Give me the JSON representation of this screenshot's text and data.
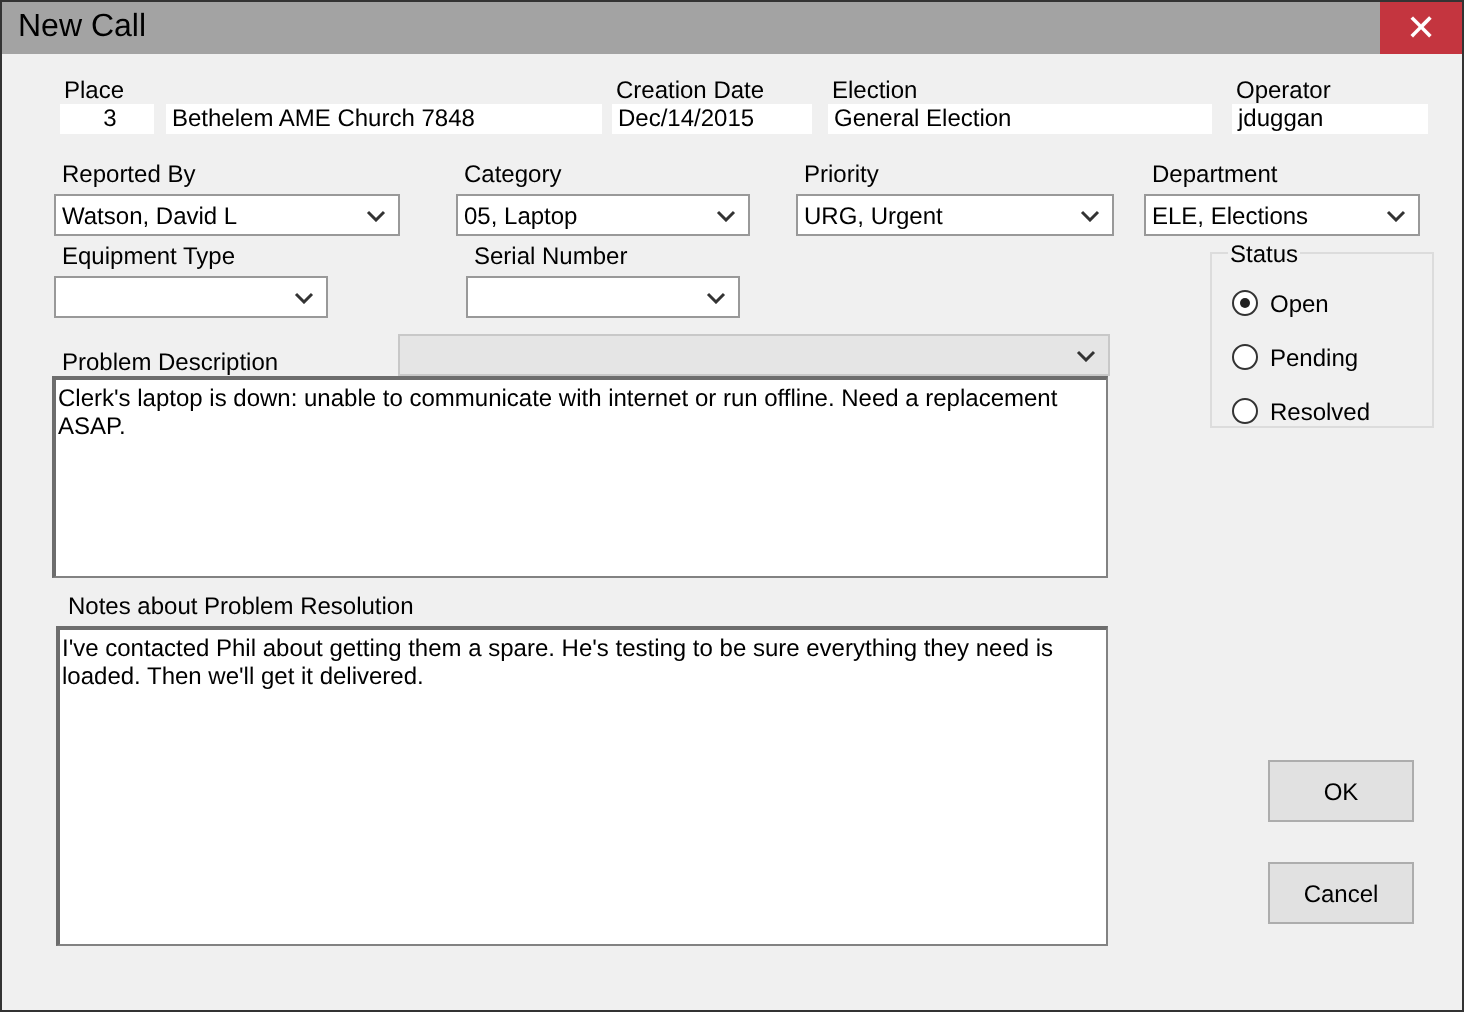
{
  "window": {
    "title": "New Call",
    "close": "✕"
  },
  "header_fields": [
    {
      "label": "Place",
      "values": [
        "3",
        "Bethelem AME Church 7848"
      ]
    },
    {
      "label": "Creation Date",
      "values": [
        "Dec/14/2015"
      ]
    },
    {
      "label": "Election",
      "values": [
        "General Election"
      ]
    },
    {
      "label": "Operator",
      "values": [
        "jduggan"
      ]
    }
  ],
  "dropdowns": [
    {
      "label": "Reported By",
      "value": "Watson, David L"
    },
    {
      "label": "Category",
      "value": "05, Laptop"
    },
    {
      "label": "Priority",
      "value": "URG, Urgent"
    },
    {
      "label": "Department",
      "value": "ELE, Elections"
    },
    {
      "label": "Equipment Type"
    },
    {
      "label": "Serial Number"
    }
  ],
  "status": {
    "label": "Status",
    "options": [
      {
        "label": "Open",
        "selected": true
      },
      {
        "label": "Pending",
        "selected": false
      },
      {
        "label": "Resolved",
        "selected": false
      }
    ]
  },
  "problem_description": {
    "label": "Problem Description",
    "dropdown_disabled": true,
    "text": "Clerk's laptop is down: unable to communicate with internet or run offline. Need a replacement ASAP."
  },
  "resolution_notes": {
    "label": "Notes about Problem Resolution",
    "text": "I've contacted Phil about getting them a spare. He's testing to be sure everything they need is loaded. Then we'll get it delivered."
  },
  "buttons": [
    "OK",
    "Cancel"
  ]
}
